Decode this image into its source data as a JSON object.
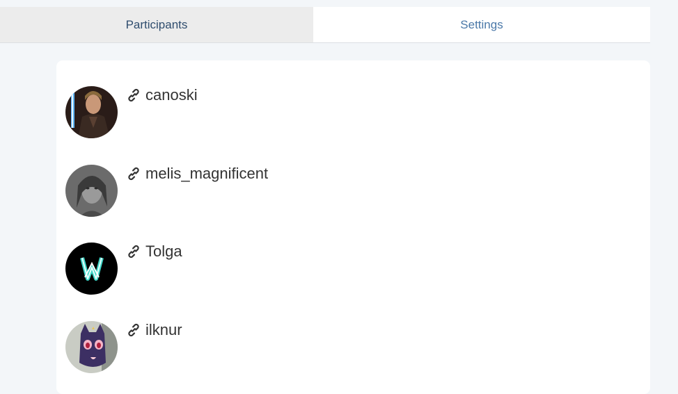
{
  "tabs": {
    "participants_label": "Participants",
    "settings_label": "Settings"
  },
  "participants": [
    {
      "name": "canoski",
      "icon": "link-icon"
    },
    {
      "name": "melis_magnificent",
      "icon": "link-icon"
    },
    {
      "name": "Tolga",
      "icon": "link-icon"
    },
    {
      "name": "ilknur",
      "icon": "link-icon"
    }
  ],
  "colors": {
    "page_background": "#f3f6f9",
    "tab_active_bg": "#ececec",
    "tab_text_dark": "#2f4d6e",
    "tab_text_link": "#4a78a8",
    "name_text": "#333333"
  }
}
